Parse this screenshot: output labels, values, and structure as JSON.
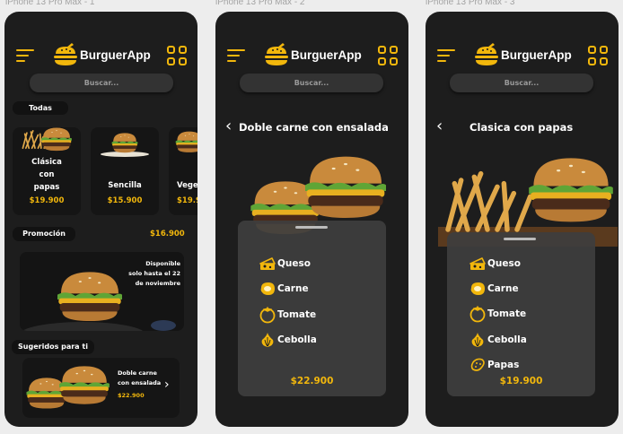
{
  "frames": [
    {
      "label": "iPhone 13 Pro Max - 1",
      "header": {
        "app_name": "BurguerApp",
        "menu_icon": "hamburger-menu-icon",
        "grid_icon": "grid-icon"
      },
      "search": {
        "placeholder": "Buscar..."
      },
      "categories": {
        "active": "Todas"
      },
      "products": [
        {
          "name_lines": [
            "Clásica",
            "con",
            "papas"
          ],
          "price": "$19.900"
        },
        {
          "name_lines": [
            "Sencilla"
          ],
          "price": "$15.900"
        },
        {
          "name_lines": [
            "Vege"
          ],
          "price": "$19.9"
        }
      ],
      "promo": {
        "label": "Promoción",
        "price": "$16.900",
        "text_lines": [
          "Disponible",
          "solo hasta el 22",
          "de noviembre"
        ]
      },
      "suggested": {
        "label": "Sugeridos para ti",
        "name_lines": [
          "Doble carne",
          "con ensalada"
        ],
        "price": "$22.900"
      }
    },
    {
      "label": "iPhone 13 Pro Max - 2",
      "header": {
        "app_name": "BurguerApp"
      },
      "search": {
        "placeholder": "Buscar..."
      },
      "detail": {
        "title": "Doble carne con ensalada",
        "ingredients": [
          {
            "name": "Queso",
            "icon": "cheese-icon"
          },
          {
            "name": "Carne",
            "icon": "meat-icon"
          },
          {
            "name": "Tomate",
            "icon": "tomato-icon"
          },
          {
            "name": "Cebolla",
            "icon": "onion-icon"
          }
        ],
        "price": "$22.900"
      }
    },
    {
      "label": "iPhone 13 Pro Max - 3",
      "header": {
        "app_name": "BurguerApp"
      },
      "search": {
        "placeholder": "Buscar..."
      },
      "detail": {
        "title": "Clasica con papas",
        "ingredients": [
          {
            "name": "Queso",
            "icon": "cheese-icon"
          },
          {
            "name": "Carne",
            "icon": "meat-icon"
          },
          {
            "name": "Tomate",
            "icon": "tomato-icon"
          },
          {
            "name": "Cebolla",
            "icon": "onion-icon"
          },
          {
            "name": "Papas",
            "icon": "potato-icon"
          }
        ],
        "price": "$19.900"
      }
    }
  ],
  "colors": {
    "accent": "#f2b70c",
    "background": "#1d1d1d",
    "card": "#151515",
    "text": "#ffffff"
  }
}
